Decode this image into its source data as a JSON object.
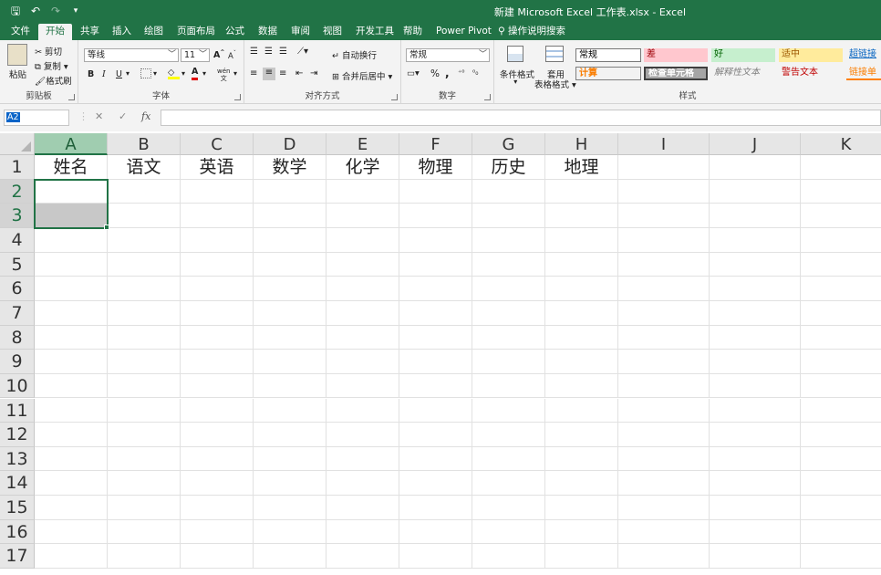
{
  "titlebar": {
    "title": "新建 Microsoft Excel 工作表.xlsx - Excel",
    "quick_access": [
      "save-icon",
      "undo-icon",
      "redo-icon",
      "customize-icon"
    ]
  },
  "tabs": [
    "文件",
    "开始",
    "共享",
    "插入",
    "绘图",
    "页面布局",
    "公式",
    "数据",
    "审阅",
    "视图",
    "开发工具",
    "帮助",
    "Power Pivot",
    "操作说明搜索"
  ],
  "active_tab": "开始",
  "ribbon": {
    "clipboard": {
      "paste": "粘贴",
      "cut": "剪切",
      "copy": "复制",
      "format_painter": "格式刷",
      "label": "剪贴板"
    },
    "font": {
      "name": "等线",
      "size": "11",
      "bold": "B",
      "italic": "I",
      "underline": "U",
      "grow": "A",
      "shrink": "A",
      "color_a": "A",
      "wen": "wén",
      "label": "字体"
    },
    "alignment": {
      "wrap": "自动换行",
      "merge": "合并后居中",
      "label": "对齐方式"
    },
    "number": {
      "format": "常规",
      "percent": "%",
      "comma": ",",
      "label": "数字"
    },
    "styles": {
      "cond_format": "条件格式",
      "table_format_1": "套用",
      "table_format_2": "表格格式",
      "label": "样式",
      "cells": [
        "常规",
        "差",
        "好",
        "适中",
        "超链接",
        "计算",
        "检查单元格",
        "解释性文本",
        "警告文本",
        "链接单"
      ]
    },
    "colors": {
      "accent": "#217346",
      "bad_bg": "#ffc7ce",
      "bad_fg": "#9c0006",
      "good_bg": "#c6efce",
      "good_fg": "#006100",
      "neutral_bg": "#ffeb9c",
      "neutral_fg": "#9c5700"
    }
  },
  "formula_bar": {
    "name_box": "A2",
    "cancel": "✕",
    "enter": "✓",
    "fx": "fx",
    "value": ""
  },
  "sheet": {
    "columns": [
      "A",
      "B",
      "C",
      "D",
      "E",
      "F",
      "G",
      "H",
      "I",
      "J",
      "K"
    ],
    "rows": [
      "1",
      "2",
      "3",
      "4",
      "5",
      "6",
      "7",
      "8",
      "9",
      "10",
      "11",
      "12",
      "13",
      "14",
      "15",
      "16",
      "17"
    ],
    "headers_row": [
      "姓名",
      "语文",
      "英语",
      "数学",
      "化学",
      "物理",
      "历史",
      "地理"
    ],
    "selected_column": "A",
    "selected_range": "A2:A3"
  }
}
